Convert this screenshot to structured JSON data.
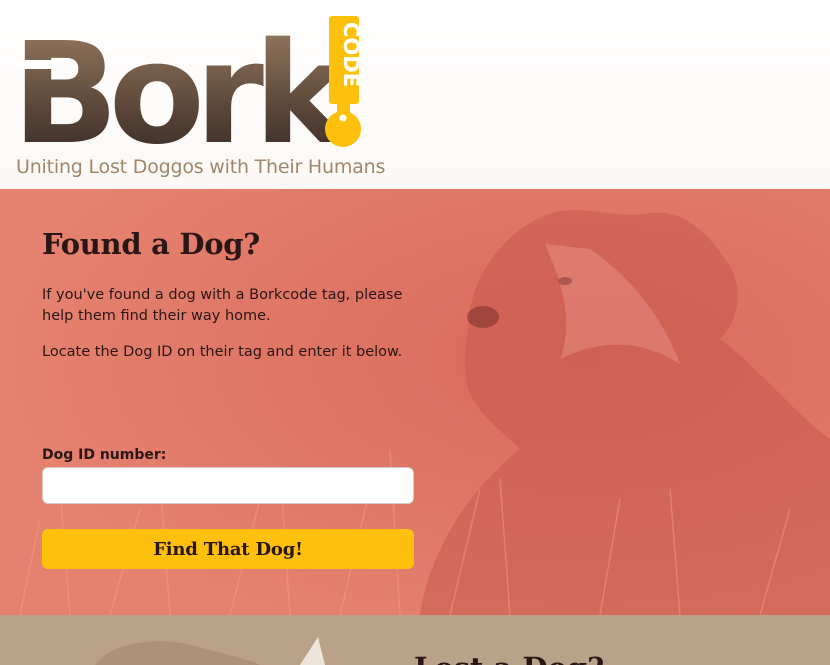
{
  "header": {
    "logo_text": "Bork",
    "logo_tag_text": "CODE",
    "tagline": "Uniting Lost Doggos with Their Humans"
  },
  "hero": {
    "title": "Found a Dog?",
    "paragraph_1": "If you've found a dog with a Borkcode tag, please help them find their way home.",
    "paragraph_2": "Locate the Dog ID on their tag and enter it below.",
    "form": {
      "label": "Dog ID number:",
      "input_value": "",
      "input_placeholder": "",
      "button_label": "Find That Dog!"
    }
  },
  "next_section": {
    "heading_partial": "Lost a Dog?"
  },
  "colors": {
    "hero_overlay": "#e27a6b",
    "accent_yellow": "#fcc00d",
    "logo_brown": "#5a4636",
    "tagline_tan": "#a0866c",
    "text_dark": "#2a1616",
    "next_section_bg": "#b9a288"
  },
  "icons": {
    "logo_tag": "dog-tag-icon"
  }
}
